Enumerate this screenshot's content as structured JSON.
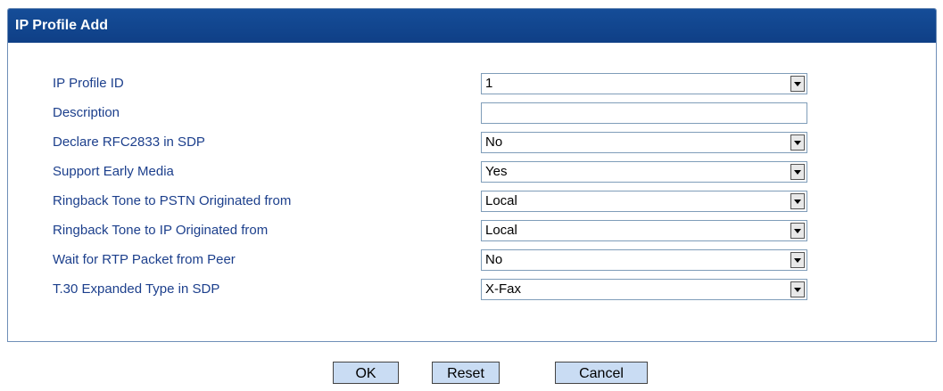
{
  "panel": {
    "title": "IP Profile Add"
  },
  "fields": [
    {
      "label": "IP Profile ID",
      "type": "select",
      "value": "1"
    },
    {
      "label": "Description",
      "type": "text",
      "value": ""
    },
    {
      "label": "Declare RFC2833 in SDP",
      "type": "select",
      "value": "No"
    },
    {
      "label": "Support Early Media",
      "type": "select",
      "value": "Yes"
    },
    {
      "label": "Ringback Tone to PSTN Originated from",
      "type": "select",
      "value": "Local"
    },
    {
      "label": "Ringback Tone to IP Originated from",
      "type": "select",
      "value": "Local"
    },
    {
      "label": "Wait for RTP Packet from Peer",
      "type": "select",
      "value": "No"
    },
    {
      "label": "T.30 Expanded Type in SDP",
      "type": "select",
      "value": "X-Fax"
    }
  ],
  "buttons": {
    "ok": "OK",
    "reset": "Reset",
    "cancel": "Cancel"
  },
  "colors": {
    "header_bg": "#154d98",
    "label_text": "#1c3f8c",
    "button_bg": "#c9dcf3"
  }
}
